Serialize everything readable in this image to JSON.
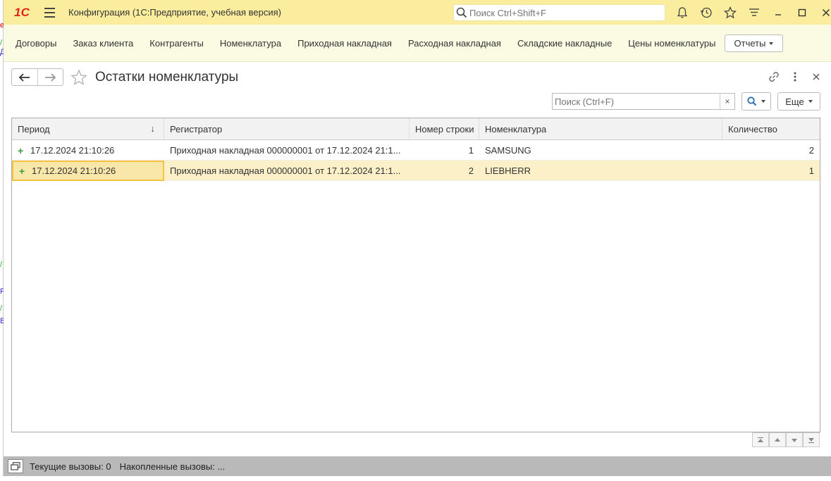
{
  "titlebar": {
    "app_title": "Конфигурация  (1С:Предприятие, учебная версия)",
    "logo_text": "1С",
    "search_placeholder": "Поиск Ctrl+Shift+F",
    "icons": [
      "bell-icon",
      "history-icon",
      "star-icon",
      "menu-lines-icon",
      "minimize-icon",
      "maximize-icon",
      "close-icon"
    ]
  },
  "sections": {
    "items": [
      "Договоры",
      "Заказ клиента",
      "Контрагенты",
      "Номенклатура",
      "Приходная накладная",
      "Расходная накладная",
      "Складские накладные",
      "Цены номенклатуры"
    ],
    "reports_label": "Отчеты"
  },
  "form": {
    "title": "Остатки номенклатуры",
    "search_placeholder": "Поиск (Ctrl+F)",
    "clear_label": "×",
    "more_label": "Еще"
  },
  "table": {
    "columns": [
      "Период",
      "Регистратор",
      "Номер строки",
      "Номенклатура",
      "Количество"
    ],
    "sort_indicator": "↓",
    "rows": [
      {
        "period": "17.12.2024 21:10:26",
        "registrator": "Приходная накладная 000000001 от 17.12.2024 21:1...",
        "line_no": "1",
        "item": "SAMSUNG",
        "qty": "2"
      },
      {
        "period": "17.12.2024 21:10:26",
        "registrator": "Приходная накладная 000000001 от 17.12.2024 21:1...",
        "line_no": "2",
        "item": "LIEBHERR",
        "qty": "1"
      }
    ]
  },
  "statusbar": {
    "current_calls": "Текущие вызовы: 0",
    "accumulated_calls": "Накопленные вызовы: ..."
  },
  "colors": {
    "titlebar_bg": "#fbed9e",
    "sections_bg": "#fbfbe3",
    "selected_row": "#fbf0c8",
    "focus_border": "#f5c341",
    "plus_green": "#3a9b3a",
    "logo_red": "#e2231a"
  }
}
